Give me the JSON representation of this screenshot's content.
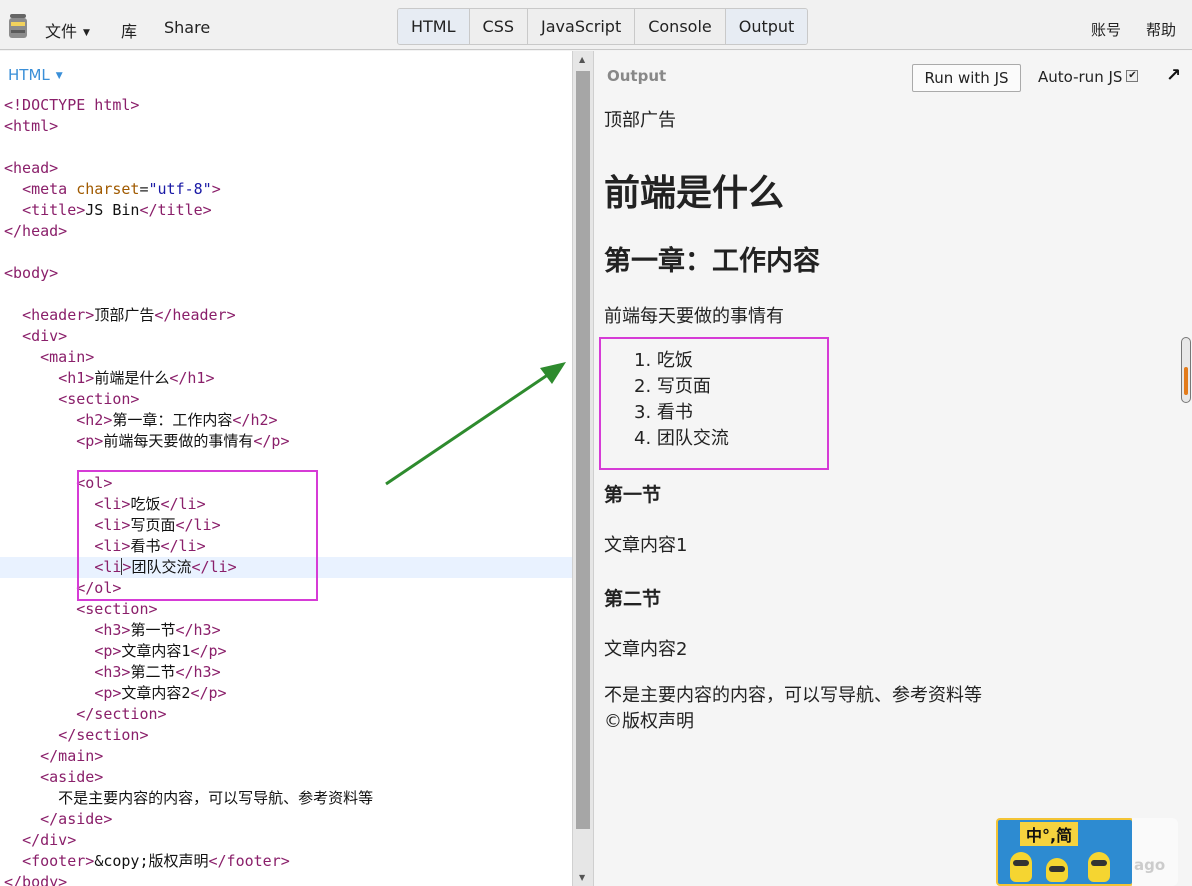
{
  "topbar": {
    "file_menu": "文件",
    "library": "库",
    "share": "Share",
    "tabs": [
      "HTML",
      "CSS",
      "JavaScript",
      "Console",
      "Output"
    ],
    "account": "账号",
    "help": "帮助"
  },
  "editor": {
    "label": "HTML",
    "lines": [
      "<!DOCTYPE html>",
      "<html>",
      "",
      "<head>",
      "  <meta charset=\"utf-8\">",
      "  <title>JS Bin</title>",
      "</head>",
      "",
      "<body>",
      "",
      "  <header>顶部广告</header>",
      "  <div>",
      "    <main>",
      "      <h1>前端是什么</h1>",
      "      <section>",
      "        <h2>第一章：工作内容</h2>",
      "        <p>前端每天要做的事情有</p>",
      "",
      "        <ol>",
      "          <li>吃饭</li>",
      "          <li>写页面</li>",
      "          <li>看书</li>",
      "          <li>团队交流</li>",
      "        </ol>",
      "        <section>",
      "          <h3>第一节</h3>",
      "          <p>文章内容1</p>",
      "          <h3>第二节</h3>",
      "          <p>文章内容2</p>",
      "        </section>",
      "      </section>",
      "    </main>",
      "    <aside>",
      "      不是主要内容的内容，可以写导航、参考资料等",
      "    </aside>",
      "  </div>",
      "  <footer>&copy;版权声明</footer>",
      "</body>"
    ]
  },
  "output": {
    "label": "Output",
    "run_button": "Run with JS",
    "autorun": "Auto-run JS",
    "header": "顶部广告",
    "h1": "前端是什么",
    "h2": "第一章：工作内容",
    "p_intro": "前端每天要做的事情有",
    "list": [
      "1. 吃饭",
      "2. 写页面",
      "3. 看书",
      "4. 团队交流"
    ],
    "h3_a": "第一节",
    "p_a": "文章内容1",
    "h3_b": "第二节",
    "p_b": "文章内容2",
    "aside": "不是主要内容的内容，可以写导航、参考资料等",
    "footer": "©版权声明"
  },
  "sticker": {
    "text": "中°,简",
    "ghost_text": "ago"
  },
  "colors": {
    "highlight_box": "#d63bd6",
    "arrow": "#2e8b2e",
    "editor_label": "#3a8fd8"
  }
}
